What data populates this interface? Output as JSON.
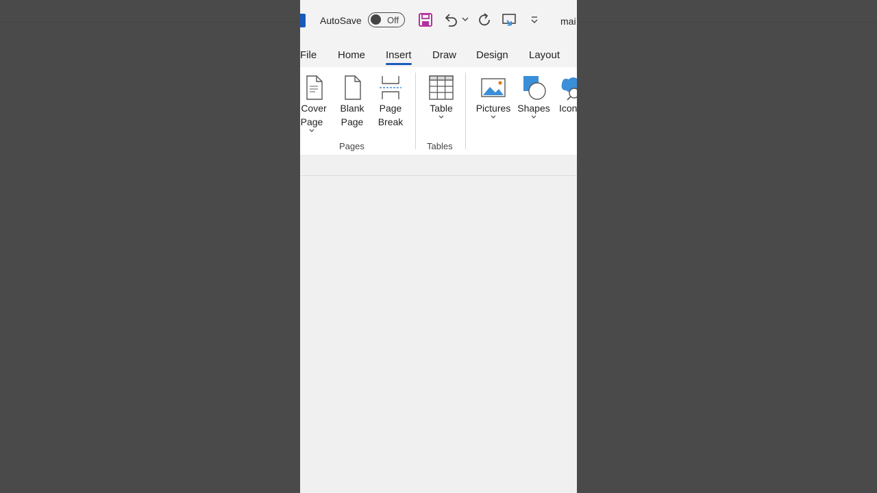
{
  "titlebar": {
    "autosave_label": "AutoSave",
    "autosave_state": "Off",
    "doc_name": "mai"
  },
  "tabs": [
    {
      "label": "File"
    },
    {
      "label": "Home"
    },
    {
      "label": "Insert",
      "active": true
    },
    {
      "label": "Draw"
    },
    {
      "label": "Design"
    },
    {
      "label": "Layout"
    }
  ],
  "ribbon": {
    "buttons": {
      "cover_page": [
        "Cover",
        "Page"
      ],
      "blank_page": [
        "Blank",
        "Page"
      ],
      "page_break": [
        "Page",
        "Break"
      ],
      "table": "Table",
      "pictures": "Pictures",
      "shapes": "Shapes",
      "icons": "Icons"
    },
    "groups": {
      "pages": "Pages",
      "tables": "Tables"
    }
  },
  "colors": {
    "accent": "#185abd",
    "save_icon": "#b3309e"
  }
}
